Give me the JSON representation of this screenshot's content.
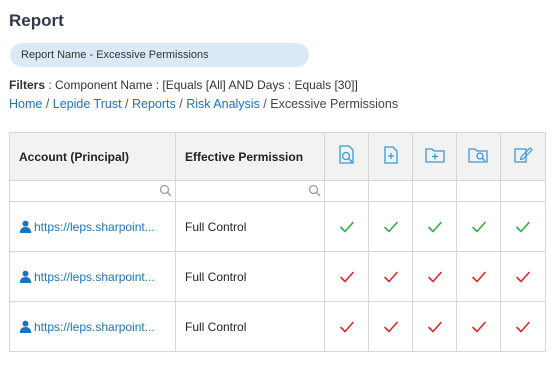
{
  "page": {
    "title": "Report"
  },
  "report_name": "Report Name - Excessive Permissions",
  "filters": {
    "label": "Filters",
    "text": " : Component Name : [Equals [All] AND Days : Equals [30]]"
  },
  "breadcrumb": {
    "items": [
      "Home",
      "Lepide Trust",
      "Reports",
      "Risk Analysis"
    ],
    "current": "Excessive Permissions",
    "separator": " / "
  },
  "table": {
    "columns": [
      "Account (Principal)",
      "Effective Permission"
    ],
    "icon_columns": [
      "view-folder-icon",
      "add-file-icon",
      "add-folder-icon",
      "find-folder-icon",
      "edit-document-icon"
    ],
    "rows": [
      {
        "account": "https://leps.sharpoint...",
        "permission": "Full Control",
        "checks": [
          "green",
          "green",
          "green",
          "green",
          "green"
        ]
      },
      {
        "account": "https://leps.sharpoint...",
        "permission": "Full Control",
        "checks": [
          "red",
          "red",
          "red",
          "red",
          "red"
        ]
      },
      {
        "account": "https://leps.sharpoint...",
        "permission": "Full Control",
        "checks": [
          "red",
          "red",
          "red",
          "red",
          "red"
        ]
      }
    ]
  },
  "colors": {
    "accent": "#1b75bc",
    "green_check": "#2fae4a",
    "red_check": "#d62c2c",
    "pill_bg": "#dbe9f7"
  }
}
